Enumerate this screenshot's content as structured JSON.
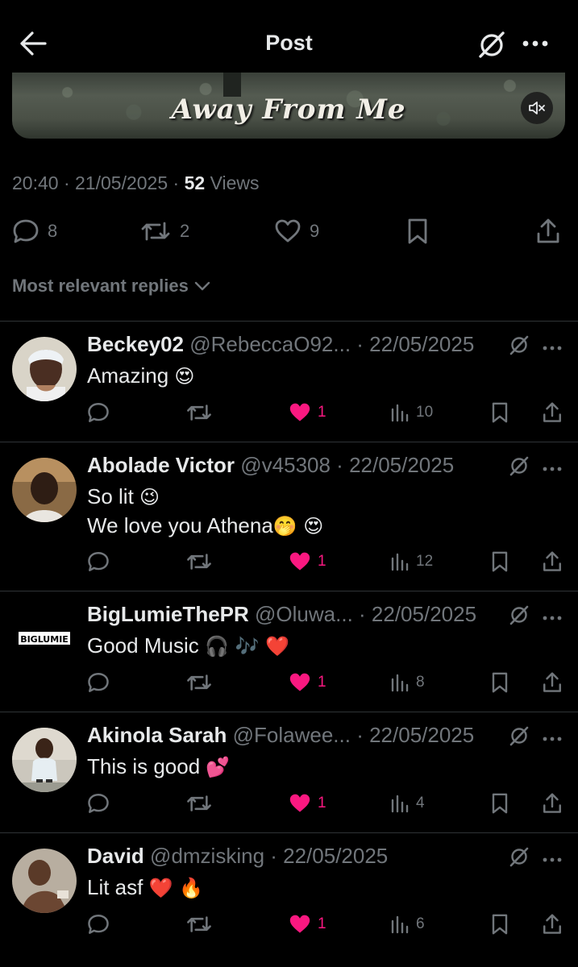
{
  "header": {
    "title": "Post"
  },
  "media": {
    "caption": "Away From Me"
  },
  "meta": {
    "time": "20:40",
    "date": "21/05/2025",
    "views_count": "52",
    "views_label": "Views"
  },
  "actions": {
    "replies": "8",
    "reposts": "2",
    "likes": "9"
  },
  "sort": {
    "label": "Most relevant replies"
  },
  "replies": [
    {
      "name": "Beckey02",
      "handle": "@RebeccaO92...",
      "date": "22/05/2025",
      "line1": "Amazing ",
      "emoji1": "😍",
      "line2": "",
      "emoji2": "",
      "likes": "1",
      "views": "10"
    },
    {
      "name": "Abolade Victor",
      "handle": "@v45308",
      "date": "22/05/2025",
      "line1": "So lit ",
      "emoji1": "😉",
      "line2": "We love you Athena",
      "emoji2": "🤭 😍",
      "likes": "1",
      "views": "12"
    },
    {
      "name": "BigLumieThePR",
      "handle": "@Oluwa...",
      "date": "22/05/2025",
      "line1": "Good Music ",
      "emoji1": "🎧 🎶 ❤️",
      "line2": "",
      "emoji2": "",
      "likes": "1",
      "views": "8",
      "avatar_text": "BIGLUMIE"
    },
    {
      "name": "Akinola Sarah",
      "handle": "@Folawee...",
      "date": "22/05/2025",
      "line1": "This is good ",
      "emoji1": "💕",
      "line2": "",
      "emoji2": "",
      "likes": "1",
      "views": "4"
    },
    {
      "name": "David",
      "handle": "@dmzisking",
      "date": "22/05/2025",
      "line1": "Lit asf ",
      "emoji1": "❤️ 🔥",
      "line2": "",
      "emoji2": "",
      "likes": "1",
      "views": "6"
    }
  ],
  "colors": {
    "background": "#000000",
    "text": "#e7e9ea",
    "muted": "#71767b",
    "like": "#f91880",
    "divider": "#2f3336"
  }
}
